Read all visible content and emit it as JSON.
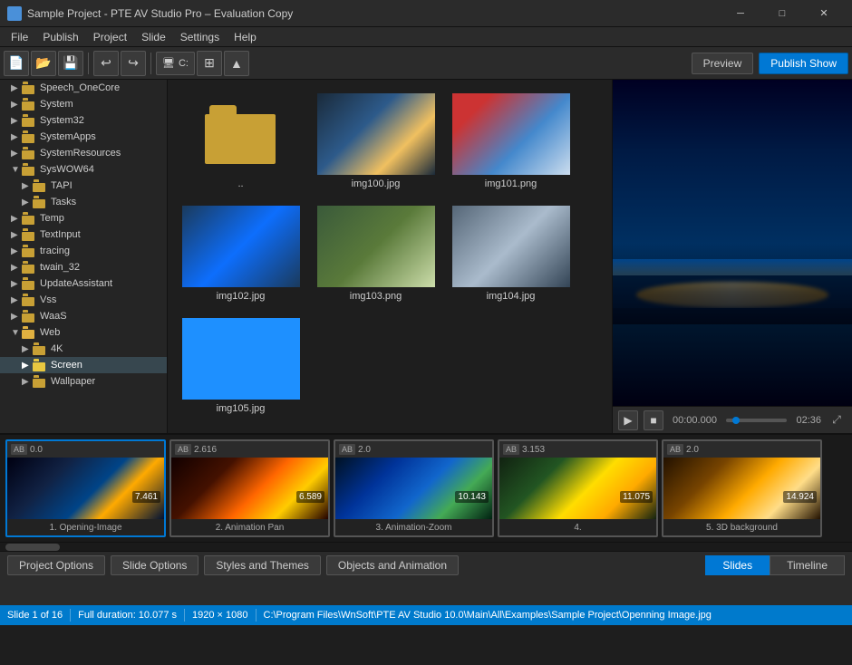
{
  "titlebar": {
    "title": "Sample Project - PTE AV Studio Pro – Evaluation Copy",
    "min_btn": "─",
    "max_btn": "□",
    "close_btn": "✕"
  },
  "menubar": {
    "items": [
      "File",
      "Publish",
      "Project",
      "Slide",
      "Settings",
      "Help"
    ]
  },
  "toolbar": {
    "drive_label": "C:",
    "preview_label": "Preview",
    "publish_label": "Publish Show"
  },
  "sidebar": {
    "items": [
      {
        "label": "Speech_OneCore",
        "indent": 1,
        "expanded": false
      },
      {
        "label": "System",
        "indent": 1,
        "expanded": false
      },
      {
        "label": "System32",
        "indent": 1,
        "expanded": false
      },
      {
        "label": "SystemApps",
        "indent": 1,
        "expanded": false
      },
      {
        "label": "SystemResources",
        "indent": 1,
        "expanded": false
      },
      {
        "label": "SysWOW64",
        "indent": 1,
        "expanded": false
      },
      {
        "label": "TAPI",
        "indent": 2,
        "expanded": false
      },
      {
        "label": "Tasks",
        "indent": 2,
        "expanded": false
      },
      {
        "label": "Temp",
        "indent": 1,
        "expanded": false
      },
      {
        "label": "TextInput",
        "indent": 1,
        "expanded": false
      },
      {
        "label": "tracing",
        "indent": 1,
        "expanded": false
      },
      {
        "label": "twain_32",
        "indent": 1,
        "expanded": false
      },
      {
        "label": "UpdateAssistant",
        "indent": 1,
        "expanded": false
      },
      {
        "label": "Vss",
        "indent": 1,
        "expanded": false
      },
      {
        "label": "WaaS",
        "indent": 1,
        "expanded": false
      },
      {
        "label": "Web",
        "indent": 1,
        "expanded": true
      },
      {
        "label": "4K",
        "indent": 2,
        "expanded": false
      },
      {
        "label": "Screen",
        "indent": 2,
        "expanded": false,
        "selected": true
      },
      {
        "label": "Wallpaper",
        "indent": 2,
        "expanded": false
      }
    ]
  },
  "files": [
    {
      "type": "folder",
      "label": ".."
    },
    {
      "type": "image",
      "label": "img100.jpg",
      "color": "img-arch"
    },
    {
      "type": "image",
      "label": "img101.png",
      "color": "img-boat"
    },
    {
      "type": "image",
      "label": "img102.jpg",
      "color": "img-blue-cave"
    },
    {
      "type": "image",
      "label": "img103.png",
      "color": "img-landscape"
    },
    {
      "type": "image",
      "label": "img104.jpg",
      "color": "img-cliff"
    },
    {
      "type": "image",
      "label": "img105.jpg",
      "color": "img-blue-solid"
    }
  ],
  "preview": {
    "time_current": "00:00.000",
    "time_total": "02:36"
  },
  "slides": [
    {
      "id": 1,
      "ab_num": "0.0",
      "label": "1. Opening-Image",
      "time": "7.461",
      "color": "img-night-city",
      "active": true
    },
    {
      "id": 2,
      "ab_num": "2.616",
      "label": "2. Animation Pan",
      "time": "6.589",
      "color": "img-sunset"
    },
    {
      "id": 3,
      "ab_num": "2.0",
      "label": "3. Animation-Zoom",
      "time": "10.143",
      "color": "img-island"
    },
    {
      "id": 4,
      "ab_num": "3.153",
      "label": "4.",
      "time": "11.075",
      "color": "img-flower"
    },
    {
      "id": 5,
      "ab_num": "2.0",
      "label": "5. 3D background",
      "time": "14.924",
      "color": "img-3dbg"
    }
  ],
  "bottom_buttons": {
    "project_options": "Project Options",
    "slide_options": "Slide Options",
    "styles_themes": "Styles and Themes",
    "objects_animation": "Objects and Animation",
    "tab_slides": "Slides",
    "tab_timeline": "Timeline"
  },
  "statusbar": {
    "slide_info": "Slide 1 of 16",
    "duration": "Full duration: 10.077 s",
    "resolution": "1920 × 1080",
    "path": "C:\\Program Files\\WnSoft\\PTE AV Studio 10.0\\Main\\All\\Examples\\Sample Project\\Openning Image.jpg"
  }
}
